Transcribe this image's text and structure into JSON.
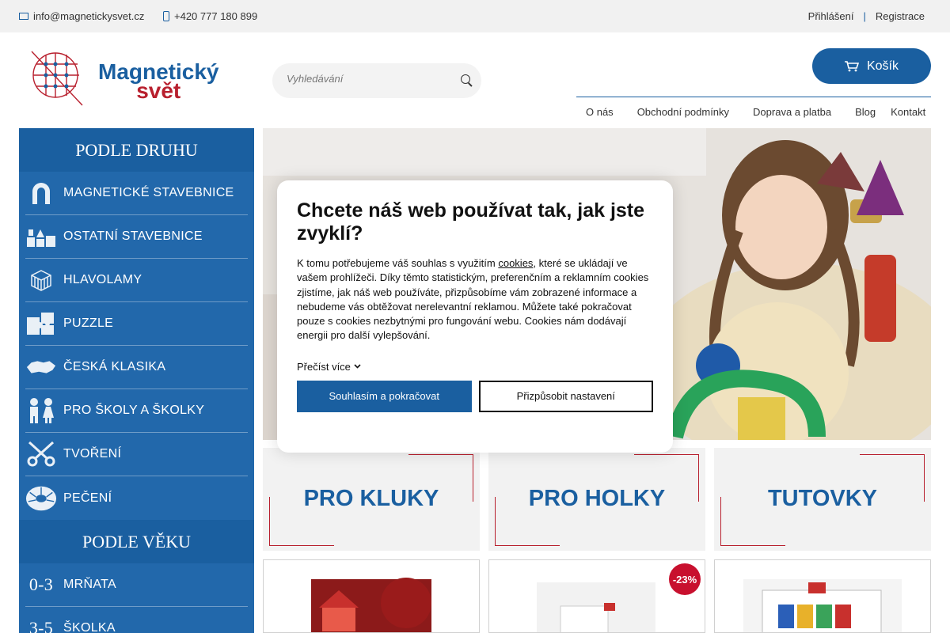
{
  "topbar": {
    "email": "info@magnetickysvet.cz",
    "phone": "+420 777 180 899",
    "login": "Přihlášení",
    "separator": "|",
    "register": "Registrace"
  },
  "header": {
    "logo_line1": "Magnetický",
    "logo_line2": "svět",
    "search_placeholder": "Vyhledávání",
    "cart_label": "Košík",
    "nav": [
      "O nás",
      "Obchodní podmínky",
      "Doprava a platba",
      "Blog",
      "Kontakt"
    ]
  },
  "sidebar": {
    "by_type_title": "PODLE DRUHU",
    "by_type": [
      {
        "label": "MAGNETICKÉ STAVEBNICE",
        "icon": "magnet-icon"
      },
      {
        "label": "OSTATNÍ STAVEBNICE",
        "icon": "blocks-icon"
      },
      {
        "label": "HLAVOLAMY",
        "icon": "cube-icon"
      },
      {
        "label": "PUZZLE",
        "icon": "puzzle-icon"
      },
      {
        "label": "ČESKÁ KLASIKA",
        "icon": "czech-map-icon"
      },
      {
        "label": "PRO ŠKOLY A ŠKOLKY",
        "icon": "kids-icon"
      },
      {
        "label": "TVOŘENÍ",
        "icon": "scissors-icon"
      },
      {
        "label": "PEČENÍ",
        "icon": "cake-mold-icon"
      }
    ],
    "by_age_title": "PODLE VĚKU",
    "by_age": [
      {
        "range": "0-3",
        "label": "MRŇATA"
      },
      {
        "range": "3-5",
        "label": "ŠKOLKA"
      }
    ]
  },
  "tiles": [
    "PRO KLUKY",
    "PRO HOLKY",
    "TUTOVKY"
  ],
  "products": {
    "discount_badge": "-23%"
  },
  "cookie": {
    "title": "Chcete náš web používat tak, jak jste zvyklí?",
    "text_before_link": "K tomu potřebujeme váš souhlas s využitím ",
    "link": "cookies",
    "text_after_link": ", které se ukládají ve vašem prohlížeči. Díky těmto statistickým, preferenčním a reklamním cookies zjistíme, jak náš web používáte, přizpůsobíme vám zobrazené informace a nebudeme vás obtěžovat nerelevantní reklamou. Můžete také pokračovat pouze s cookies nezbytnými pro fungování webu. Cookies nám dodávají energii pro další vylepšování.",
    "read_more": "Přečíst více",
    "accept": "Souhlasím a pokračovat",
    "customize": "Přizpůsobit nastavení"
  },
  "colors": {
    "brand_blue": "#1a5fa0",
    "brand_red": "#b8202e",
    "badge_red": "#c8102e"
  }
}
